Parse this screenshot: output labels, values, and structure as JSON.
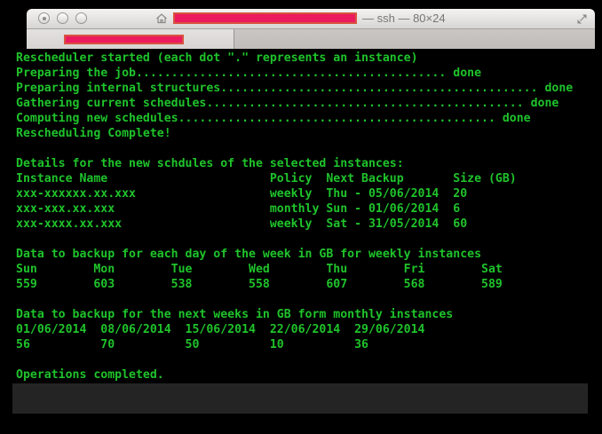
{
  "window": {
    "title": "— ssh — 80×24",
    "buttons": {
      "close": "close-button",
      "minimize": "minimize-button",
      "zoom": "zoom-button"
    },
    "icons": {
      "proxy": "home-icon",
      "fullscreen": "fullscreen-arrows-icon"
    },
    "redactions": {
      "titlebar_host_hidden": true,
      "tab_label_hidden": true
    }
  },
  "colors": {
    "terminal_green": "#1fc32b",
    "terminal_background": "#000000",
    "redaction_pink": "#ec1a5e",
    "redaction_border": "#d85340",
    "selection_gray": "#242424"
  },
  "terminal": {
    "grid": "80×24",
    "lines": [
      "Rescheduler started (each dot \".\" represents an instance)",
      "Preparing the job............................................ done",
      "Preparing internal structures............................................. done",
      "Gathering current schedules............................................. done",
      "Computing new schedules............................................. done",
      "Rescheduling Complete!",
      "",
      "Details for the new schdules of the selected instances:",
      "Instance Name                       Policy  Next Backup       Size (GB)",
      "xxx-xxxxxx.xx.xxx                   weekly  Thu - 05/06/2014  20",
      "xxx-xxx.xx.xxx                      monthly Sun - 01/06/2014  6",
      "xxx-xxxx.xx.xxx                     weekly  Sat - 31/05/2014  60",
      "",
      "Data to backup for each day of the week in GB for weekly instances",
      "Sun        Mon        Tue        Wed        Thu        Fri        Sat",
      "559        603        538        558        607        568        589",
      "",
      "Data to backup for the next weeks in GB form monthly instances",
      "01/06/2014  08/06/2014  15/06/2014  22/06/2014  29/06/2014",
      "56          70          50          10          36",
      "",
      "Operations completed.",
      "",
      ""
    ],
    "sections": {
      "progress_steps": [
        {
          "label": "Preparing the job",
          "status": "done"
        },
        {
          "label": "Preparing internal structures",
          "status": "done"
        },
        {
          "label": "Gathering current schedules",
          "status": "done"
        },
        {
          "label": "Computing new schedules",
          "status": "done"
        }
      ],
      "completion_message": "Rescheduling Complete!",
      "schedule_table": {
        "title": "Details for the new schdules of the selected instances:",
        "columns": [
          "Instance Name",
          "Policy",
          "Next Backup",
          "Size (GB)"
        ],
        "rows": [
          {
            "instance": "xxx-xxxxxx.xx.xxx",
            "policy": "weekly",
            "next_backup": "Thu - 05/06/2014",
            "size_gb": "20"
          },
          {
            "instance": "xxx-xxx.xx.xxx",
            "policy": "monthly",
            "next_backup": "Sun - 01/06/2014",
            "size_gb": "6"
          },
          {
            "instance": "xxx-xxxx.xx.xxx",
            "policy": "weekly",
            "next_backup": "Sat - 31/05/2014",
            "size_gb": "60"
          }
        ]
      },
      "weekly_backup": {
        "title": "Data to backup for each day of the week in GB for weekly instances",
        "days": [
          "Sun",
          "Mon",
          "Tue",
          "Wed",
          "Thu",
          "Fri",
          "Sat"
        ],
        "values_gb": [
          559,
          603,
          538,
          558,
          607,
          568,
          589
        ]
      },
      "monthly_backup": {
        "title": "Data to backup for the next weeks in GB form monthly instances",
        "dates": [
          "01/06/2014",
          "08/06/2014",
          "15/06/2014",
          "22/06/2014",
          "29/06/2014"
        ],
        "values_gb": [
          56,
          70,
          50,
          10,
          36
        ]
      },
      "final_message": "Operations completed."
    }
  }
}
